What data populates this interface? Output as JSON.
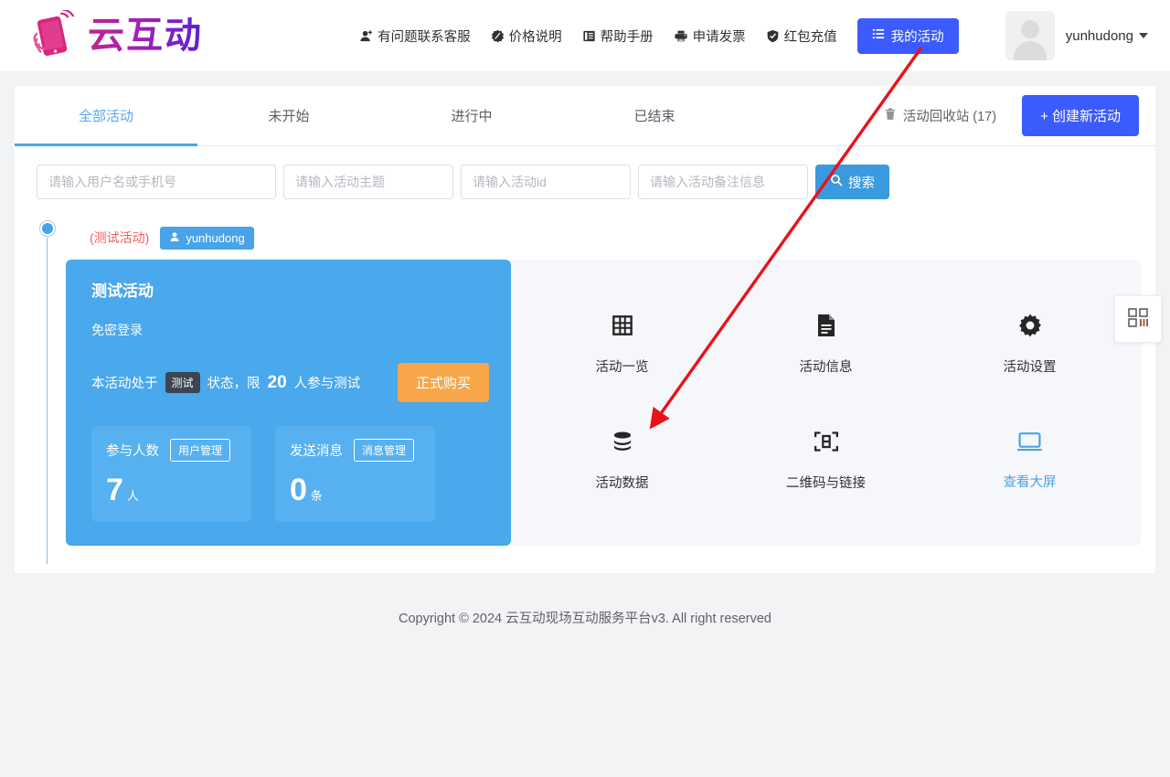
{
  "brand": {
    "logo_text": "云互动",
    "logo_icon": "phone-hand-icon"
  },
  "header": {
    "nav": [
      {
        "label": "有问题联系客服",
        "icon": "user-plus-icon"
      },
      {
        "label": "价格说明",
        "icon": "price-tag-icon"
      },
      {
        "label": "帮助手册",
        "icon": "book-icon"
      },
      {
        "label": "申请发票",
        "icon": "printer-icon"
      },
      {
        "label": "红包充值",
        "icon": "shield-check-icon"
      }
    ],
    "my_activity_button": {
      "label": "我的活动",
      "icon": "list-icon",
      "color": "#3b5bfd"
    },
    "user": {
      "name": "yunhudong",
      "avatar": "default-avatar-icon",
      "caret": "chevron-down-icon"
    }
  },
  "tabs": [
    {
      "label": "全部活动",
      "active": true
    },
    {
      "label": "未开始",
      "active": false
    },
    {
      "label": "进行中",
      "active": false
    },
    {
      "label": "已结束",
      "active": false
    }
  ],
  "toolbar": {
    "recycle_bin": {
      "label": "活动回收站 (17)",
      "icon": "trash-icon"
    },
    "create_button": "+ 创建新活动"
  },
  "search": {
    "inputs": [
      {
        "name": "username-or-phone",
        "placeholder": "请输入用户名或手机号",
        "value": ""
      },
      {
        "name": "activity-theme",
        "placeholder": "请输入活动主题",
        "value": ""
      },
      {
        "name": "activity-id",
        "placeholder": "请输入活动id",
        "value": ""
      },
      {
        "name": "activity-remark",
        "placeholder": "请输入活动备注信息",
        "value": ""
      }
    ],
    "button": {
      "label": "搜索",
      "icon": "search-icon",
      "color": "#3a9ae0"
    }
  },
  "activity": {
    "test_tag": "(测试活动)",
    "owner_badge": {
      "label": "yunhudong",
      "icon": "user-icon"
    },
    "card": {
      "title": "测试活动",
      "subtitle": "免密登录",
      "status_prefix": "本活动处于",
      "status_chip": "测试",
      "status_mid": "状态，限",
      "limit_count": "20",
      "status_suffix": "人参与测试",
      "buy_button": "正式购买",
      "stats": [
        {
          "label": "参与人数",
          "action": "用户管理",
          "value": "7",
          "unit": "人"
        },
        {
          "label": "发送消息",
          "action": "消息管理",
          "value": "0",
          "unit": "条"
        }
      ]
    },
    "actions": [
      {
        "label": "活动一览",
        "icon": "grid-icon",
        "highlight": false
      },
      {
        "label": "活动信息",
        "icon": "document-icon",
        "highlight": false
      },
      {
        "label": "活动设置",
        "icon": "gear-icon",
        "highlight": false
      },
      {
        "label": "活动数据",
        "icon": "database-icon",
        "highlight": false
      },
      {
        "label": "二维码与链接",
        "icon": "qr-scan-icon",
        "highlight": false
      },
      {
        "label": "查看大屏",
        "icon": "monitor-icon",
        "highlight": true
      }
    ]
  },
  "side_widget": {
    "icon": "qrcode-icon"
  },
  "footer": {
    "text": "Copyright © 2024 云互动现场互动服务平台v3. All right reserved"
  },
  "annotation": {
    "arrow_color": "#e8131a",
    "from": "my-activity-button",
    "to": "活动数据"
  },
  "colors": {
    "primary_blue": "#3b5bfd",
    "card_blue": "#4aa8ec",
    "accent_orange": "#f7a64a",
    "tab_active": "#48a6f0",
    "red_tag": "#f1605d"
  }
}
